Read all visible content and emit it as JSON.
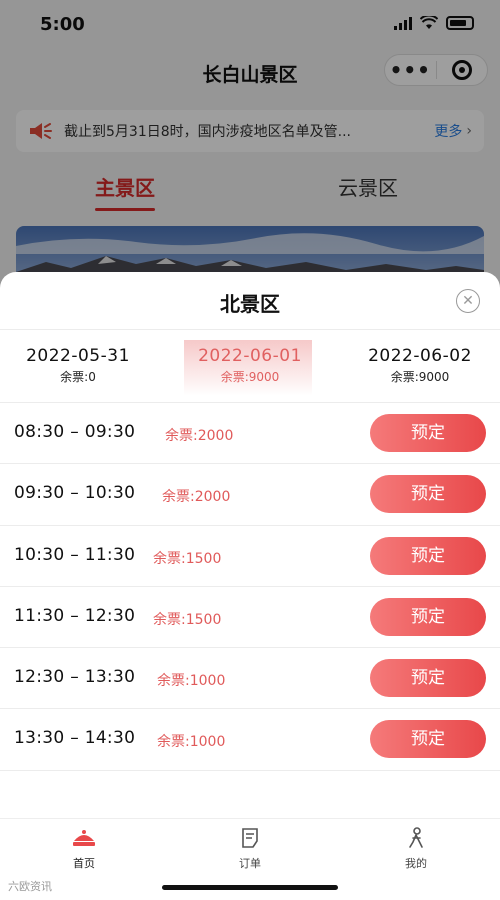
{
  "status_bar": {
    "time": "5:00"
  },
  "nav": {
    "title": "长白山景区",
    "capsule_more": "•••"
  },
  "notice": {
    "text": "截止到5月31日8时，国内涉疫地区名单及管...",
    "more_label": "更多",
    "more_chevron": "›"
  },
  "tabs": [
    {
      "label": "主景区",
      "active": true
    },
    {
      "label": "云景区",
      "active": false
    }
  ],
  "sheet": {
    "title": "北景区",
    "close_glyph": "✕",
    "dates": [
      {
        "date": "2022-05-31",
        "remaining": "余票:0",
        "selected": false
      },
      {
        "date": "2022-06-01",
        "remaining": "余票:9000",
        "selected": true
      },
      {
        "date": "2022-06-02",
        "remaining": "余票:9000",
        "selected": false
      }
    ],
    "slots": [
      {
        "time": "08:30 – 09:30",
        "remaining": "余票:2000",
        "button": "预定"
      },
      {
        "time": "09:30 – 10:30",
        "remaining": "余票:2000",
        "button": "预定"
      },
      {
        "time": "10:30 – 11:30",
        "remaining": "余票:1500",
        "button": "预定"
      },
      {
        "time": "11:30 – 12:30",
        "remaining": "余票:1500",
        "button": "预定"
      },
      {
        "time": "12:30 – 13:30",
        "remaining": "余票:1000",
        "button": "预定"
      },
      {
        "time": "13:30 – 14:30",
        "remaining": "余票:1000",
        "button": "预定"
      }
    ]
  },
  "tabbar": [
    {
      "label": "首页",
      "icon": "home-icon",
      "active": true
    },
    {
      "label": "订单",
      "icon": "order-icon",
      "active": false
    },
    {
      "label": "我的",
      "icon": "person-icon",
      "active": false
    }
  ],
  "colors": {
    "accent": "#d62b2b",
    "button_start": "#f57a7a",
    "button_end": "#e8484a",
    "link": "#2a7de1"
  },
  "watermark": "六欧资讯"
}
